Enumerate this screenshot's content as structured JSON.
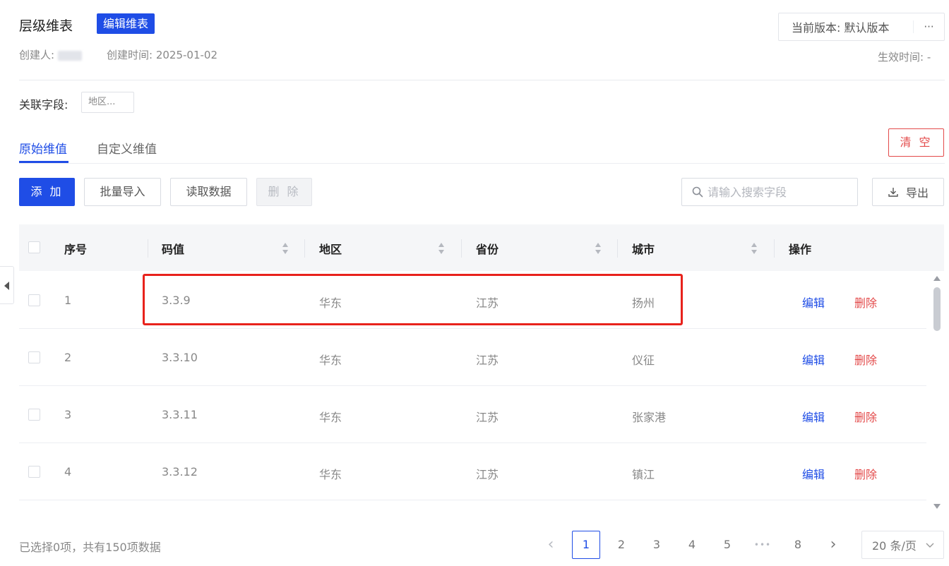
{
  "header": {
    "title": "层级维表",
    "badge": "编辑维表",
    "creator_label": "创建人:",
    "creator_value": "周某",
    "created_time_label": "创建时间:",
    "created_time_value": "2025-01-02",
    "version_label": "当前版本: 默认版本",
    "version_more": "···",
    "effective_label": "生效时间: -"
  },
  "field": {
    "label": "关联字段:",
    "tag": "地区..."
  },
  "tabs": [
    {
      "label": "原始维值",
      "active": true
    },
    {
      "label": "自定义维值",
      "active": false
    }
  ],
  "clear_label": "清 空",
  "toolbar": {
    "add": "添 加",
    "batch_import": "批量导入",
    "read_data": "读取数据",
    "delete": "删 除",
    "search_placeholder": "请输入搜索字段",
    "export": "导出"
  },
  "table": {
    "columns": [
      "序号",
      "码值",
      "地区",
      "省份",
      "城市",
      "操作"
    ],
    "rows": [
      {
        "index": "1",
        "code": "3.3.9",
        "region": "华东",
        "province": "江苏",
        "city": "扬州"
      },
      {
        "index": "2",
        "code": "3.3.10",
        "region": "华东",
        "province": "江苏",
        "city": "仪征"
      },
      {
        "index": "3",
        "code": "3.3.11",
        "region": "华东",
        "province": "江苏",
        "city": "张家港"
      },
      {
        "index": "4",
        "code": "3.3.12",
        "region": "华东",
        "province": "江苏",
        "city": "镇江"
      }
    ],
    "edit_label": "编辑",
    "delete_label": "删除"
  },
  "footer": {
    "info": "已选择0项，共有150项数据",
    "pages": [
      "1",
      "2",
      "3",
      "4",
      "5",
      "•••",
      "8"
    ],
    "active_page": "1",
    "prev": "‹",
    "next": "›",
    "page_size": "20 条/页"
  },
  "colors": {
    "primary": "#1f4de6",
    "danger": "#e34a4a",
    "highlight": "#e8221c"
  }
}
